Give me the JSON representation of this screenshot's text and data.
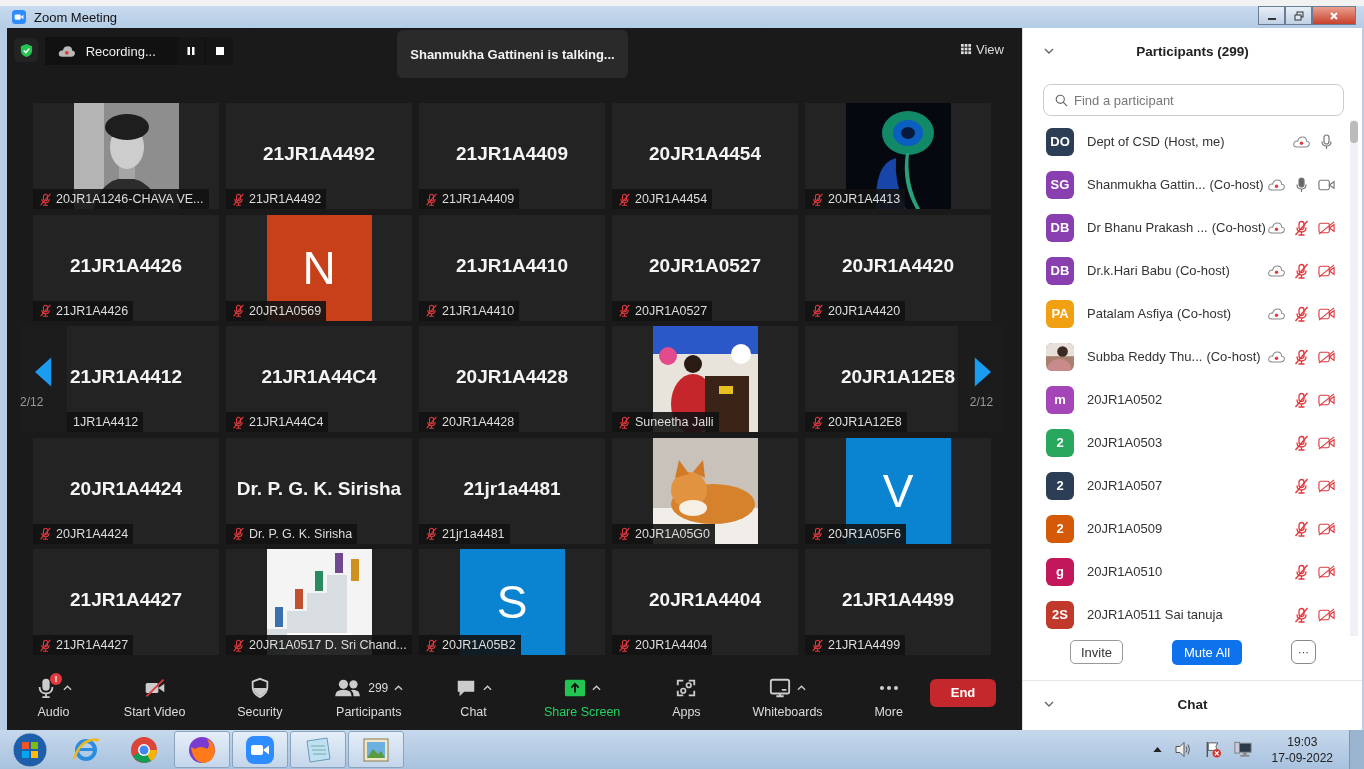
{
  "window": {
    "title": "Zoom Meeting"
  },
  "top_bar": {
    "recording": "Recording...",
    "talking": "Shanmukha Gattineni is talking...",
    "view": "View"
  },
  "nav": {
    "left_page": "2/12",
    "right_page": "2/12"
  },
  "tiles": [
    {
      "kind": "picture",
      "label": "20JR1A1246-CHAVA VE...",
      "muted": true
    },
    {
      "kind": "name",
      "title": "21JR1A4492",
      "label": "21JR1A4492",
      "muted": true
    },
    {
      "kind": "name",
      "title": "21JR1A4409",
      "label": "21JR1A4409",
      "muted": true
    },
    {
      "kind": "name",
      "title": "20JR1A4454",
      "label": "20JR1A4454",
      "muted": true
    },
    {
      "kind": "picture",
      "label": "20JR1A4413",
      "muted": true
    },
    {
      "kind": "name",
      "title": "21JR1A4426",
      "label": "21JR1A4426",
      "muted": true
    },
    {
      "kind": "letter",
      "letter": "N",
      "color": "#c8401a",
      "label": "20JR1A0569",
      "muted": true
    },
    {
      "kind": "name",
      "title": "21JR1A4410",
      "label": "21JR1A4410",
      "muted": true
    },
    {
      "kind": "name",
      "title": "20JR1A0527",
      "label": "20JR1A0527",
      "muted": true
    },
    {
      "kind": "name",
      "title": "20JR1A4420",
      "label": "20JR1A4420",
      "muted": true
    },
    {
      "kind": "name",
      "title": "21JR1A4412",
      "label": "1JR1A4412",
      "muted": false
    },
    {
      "kind": "name",
      "title": "21JR1A44C4",
      "label": "21JR1A44C4",
      "muted": true
    },
    {
      "kind": "name",
      "title": "20JR1A4428",
      "label": "20JR1A4428",
      "muted": true
    },
    {
      "kind": "picture",
      "label": "Suneetha Jalli",
      "muted": true
    },
    {
      "kind": "name",
      "title": "20JR1A12E8",
      "label": "20JR1A12E8",
      "muted": true
    },
    {
      "kind": "name",
      "title": "20JR1A4424",
      "label": "20JR1A4424",
      "muted": true
    },
    {
      "kind": "name",
      "title": "Dr. P. G. K. Sirisha",
      "label": "Dr. P. G. K. Sirisha",
      "muted": true
    },
    {
      "kind": "name",
      "title": "21jr1a4481",
      "label": "21jr1a4481",
      "muted": true
    },
    {
      "kind": "picture",
      "label": "20JR1A05G0",
      "muted": true
    },
    {
      "kind": "letter",
      "letter": "V",
      "color": "#0a84d0",
      "label": "20JR1A05F6",
      "muted": true
    },
    {
      "kind": "name",
      "title": "21JR1A4427",
      "label": "21JR1A4427",
      "muted": true
    },
    {
      "kind": "picture",
      "label": "20JR1A0517 D. Sri Chand...",
      "muted": true
    },
    {
      "kind": "letter",
      "letter": "S",
      "color": "#0a84d0",
      "label": "20JR1A05B2",
      "muted": true
    },
    {
      "kind": "name",
      "title": "20JR1A4404",
      "label": "20JR1A4404",
      "muted": true
    },
    {
      "kind": "name",
      "title": "21JR1A4499",
      "label": "21JR1A4499",
      "muted": true
    }
  ],
  "toolbar": [
    {
      "kind": "audio",
      "label": "Audio",
      "caret": true,
      "badge": "!"
    },
    {
      "kind": "video",
      "label": "Start Video",
      "caret": false
    },
    {
      "kind": "security",
      "label": "Security",
      "caret": false
    },
    {
      "kind": "participants",
      "label": "Participants",
      "count": "299",
      "caret": true
    },
    {
      "kind": "chat",
      "label": "Chat",
      "caret": true
    },
    {
      "kind": "share",
      "label": "Share Screen",
      "caret": true,
      "highlight": true
    },
    {
      "kind": "apps",
      "label": "Apps",
      "caret": false
    },
    {
      "kind": "whiteboards",
      "label": "Whiteboards",
      "caret": true
    },
    {
      "kind": "more",
      "label": "More",
      "caret": false
    }
  ],
  "end_button": "End",
  "participants": {
    "title": "Participants (299)",
    "search": {
      "placeholder": "Find a participant"
    },
    "items": [
      {
        "initials": "DO",
        "color": "#2b3e55",
        "name": "Dept of CSD",
        "role": "(Host, me)",
        "recording": true,
        "muted": false,
        "talking": false
      },
      {
        "initials": "SG",
        "color": "#8a3fb0",
        "name": "Shanmukha Gattin...",
        "role": "(Co-host)",
        "recording": true,
        "muted": false,
        "talking": true,
        "video_off": false
      },
      {
        "initials": "DB",
        "color": "#8a3fb0",
        "name": "Dr Bhanu Prakash ...",
        "role": "(Co-host)",
        "recording": true,
        "muted": true,
        "video_off": true
      },
      {
        "initials": "DB",
        "color": "#8a3fb0",
        "name": "Dr.k.Hari Babu",
        "role": "(Co-host)",
        "recording": true,
        "muted": true,
        "video_off": true
      },
      {
        "initials": "PA",
        "color": "#f0a010",
        "name": "Patalam Asfiya",
        "role": "(Co-host)",
        "recording": true,
        "muted": true,
        "video_off": true
      },
      {
        "kind": "picture",
        "name": "Subba Reddy Thu...",
        "role": "(Co-host)",
        "recording": true,
        "muted": true,
        "video_off": true
      },
      {
        "initials": "m",
        "color": "#a445b8",
        "name": "20JR1A0502",
        "recording": false,
        "muted": true,
        "video_off": true
      },
      {
        "initials": "2",
        "color": "#27a85e",
        "name": "20JR1A0503",
        "recording": false,
        "muted": true,
        "video_off": true
      },
      {
        "initials": "2",
        "color": "#2c3e55",
        "name": "20JR1A0507",
        "recording": false,
        "muted": true,
        "video_off": true
      },
      {
        "initials": "2",
        "color": "#d55a08",
        "name": "20JR1A0509",
        "recording": false,
        "muted": true,
        "video_off": true
      },
      {
        "initials": "g",
        "color": "#c2185b",
        "name": "20JR1A0510",
        "recording": false,
        "muted": true,
        "video_off": true
      },
      {
        "initials": "2S",
        "color": "#c0392b",
        "name": "20JR1A0511 Sai tanuja",
        "recording": false,
        "muted": true,
        "video_off": true
      }
    ],
    "buttons": {
      "invite": "Invite",
      "mute_all": "Mute All",
      "more": "···"
    }
  },
  "chat": {
    "title": "Chat"
  },
  "taskbar": {
    "time": "19:03",
    "date": "17-09-2022"
  }
}
